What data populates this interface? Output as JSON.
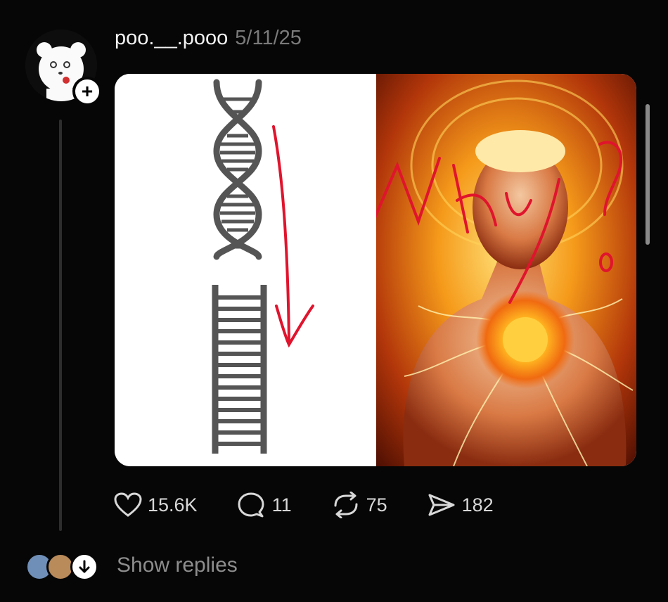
{
  "post": {
    "username": "poo.__.pooo",
    "timestamp": "5/11/25",
    "media": {
      "left_panel": "dna-to-ladder-diagram",
      "right_panel": "glowing-figure-image",
      "handwriting": "why?"
    }
  },
  "actions": {
    "likes": "15.6K",
    "comments": "11",
    "reposts": "75",
    "shares": "182"
  },
  "replies": {
    "label": "Show replies"
  },
  "colors": {
    "background": "#060606",
    "text_primary": "#f2f2f2",
    "text_muted": "#7a7a7a",
    "annotation_red": "#e0142d"
  }
}
